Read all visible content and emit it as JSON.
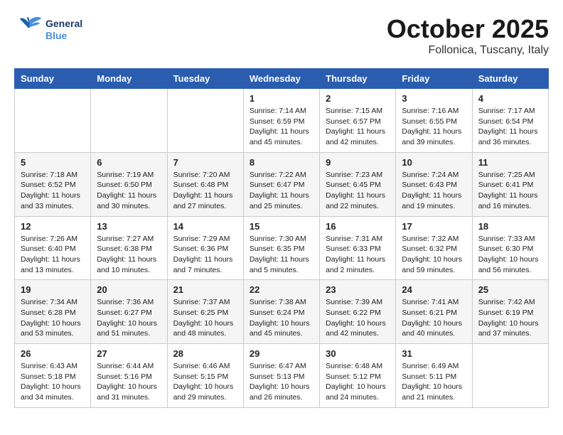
{
  "header": {
    "logo_line1": "General",
    "logo_line2": "Blue",
    "month_title": "October 2025",
    "location": "Follonica, Tuscany, Italy"
  },
  "days_of_week": [
    "Sunday",
    "Monday",
    "Tuesday",
    "Wednesday",
    "Thursday",
    "Friday",
    "Saturday"
  ],
  "weeks": [
    [
      {
        "day": "",
        "info": ""
      },
      {
        "day": "",
        "info": ""
      },
      {
        "day": "",
        "info": ""
      },
      {
        "day": "1",
        "info": "Sunrise: 7:14 AM\nSunset: 6:59 PM\nDaylight: 11 hours\nand 45 minutes."
      },
      {
        "day": "2",
        "info": "Sunrise: 7:15 AM\nSunset: 6:57 PM\nDaylight: 11 hours\nand 42 minutes."
      },
      {
        "day": "3",
        "info": "Sunrise: 7:16 AM\nSunset: 6:55 PM\nDaylight: 11 hours\nand 39 minutes."
      },
      {
        "day": "4",
        "info": "Sunrise: 7:17 AM\nSunset: 6:54 PM\nDaylight: 11 hours\nand 36 minutes."
      }
    ],
    [
      {
        "day": "5",
        "info": "Sunrise: 7:18 AM\nSunset: 6:52 PM\nDaylight: 11 hours\nand 33 minutes."
      },
      {
        "day": "6",
        "info": "Sunrise: 7:19 AM\nSunset: 6:50 PM\nDaylight: 11 hours\nand 30 minutes."
      },
      {
        "day": "7",
        "info": "Sunrise: 7:20 AM\nSunset: 6:48 PM\nDaylight: 11 hours\nand 27 minutes."
      },
      {
        "day": "8",
        "info": "Sunrise: 7:22 AM\nSunset: 6:47 PM\nDaylight: 11 hours\nand 25 minutes."
      },
      {
        "day": "9",
        "info": "Sunrise: 7:23 AM\nSunset: 6:45 PM\nDaylight: 11 hours\nand 22 minutes."
      },
      {
        "day": "10",
        "info": "Sunrise: 7:24 AM\nSunset: 6:43 PM\nDaylight: 11 hours\nand 19 minutes."
      },
      {
        "day": "11",
        "info": "Sunrise: 7:25 AM\nSunset: 6:41 PM\nDaylight: 11 hours\nand 16 minutes."
      }
    ],
    [
      {
        "day": "12",
        "info": "Sunrise: 7:26 AM\nSunset: 6:40 PM\nDaylight: 11 hours\nand 13 minutes."
      },
      {
        "day": "13",
        "info": "Sunrise: 7:27 AM\nSunset: 6:38 PM\nDaylight: 11 hours\nand 10 minutes."
      },
      {
        "day": "14",
        "info": "Sunrise: 7:29 AM\nSunset: 6:36 PM\nDaylight: 11 hours\nand 7 minutes."
      },
      {
        "day": "15",
        "info": "Sunrise: 7:30 AM\nSunset: 6:35 PM\nDaylight: 11 hours\nand 5 minutes."
      },
      {
        "day": "16",
        "info": "Sunrise: 7:31 AM\nSunset: 6:33 PM\nDaylight: 11 hours\nand 2 minutes."
      },
      {
        "day": "17",
        "info": "Sunrise: 7:32 AM\nSunset: 6:32 PM\nDaylight: 10 hours\nand 59 minutes."
      },
      {
        "day": "18",
        "info": "Sunrise: 7:33 AM\nSunset: 6:30 PM\nDaylight: 10 hours\nand 56 minutes."
      }
    ],
    [
      {
        "day": "19",
        "info": "Sunrise: 7:34 AM\nSunset: 6:28 PM\nDaylight: 10 hours\nand 53 minutes."
      },
      {
        "day": "20",
        "info": "Sunrise: 7:36 AM\nSunset: 6:27 PM\nDaylight: 10 hours\nand 51 minutes."
      },
      {
        "day": "21",
        "info": "Sunrise: 7:37 AM\nSunset: 6:25 PM\nDaylight: 10 hours\nand 48 minutes."
      },
      {
        "day": "22",
        "info": "Sunrise: 7:38 AM\nSunset: 6:24 PM\nDaylight: 10 hours\nand 45 minutes."
      },
      {
        "day": "23",
        "info": "Sunrise: 7:39 AM\nSunset: 6:22 PM\nDaylight: 10 hours\nand 42 minutes."
      },
      {
        "day": "24",
        "info": "Sunrise: 7:41 AM\nSunset: 6:21 PM\nDaylight: 10 hours\nand 40 minutes."
      },
      {
        "day": "25",
        "info": "Sunrise: 7:42 AM\nSunset: 6:19 PM\nDaylight: 10 hours\nand 37 minutes."
      }
    ],
    [
      {
        "day": "26",
        "info": "Sunrise: 6:43 AM\nSunset: 5:18 PM\nDaylight: 10 hours\nand 34 minutes."
      },
      {
        "day": "27",
        "info": "Sunrise: 6:44 AM\nSunset: 5:16 PM\nDaylight: 10 hours\nand 31 minutes."
      },
      {
        "day": "28",
        "info": "Sunrise: 6:46 AM\nSunset: 5:15 PM\nDaylight: 10 hours\nand 29 minutes."
      },
      {
        "day": "29",
        "info": "Sunrise: 6:47 AM\nSunset: 5:13 PM\nDaylight: 10 hours\nand 26 minutes."
      },
      {
        "day": "30",
        "info": "Sunrise: 6:48 AM\nSunset: 5:12 PM\nDaylight: 10 hours\nand 24 minutes."
      },
      {
        "day": "31",
        "info": "Sunrise: 6:49 AM\nSunset: 5:11 PM\nDaylight: 10 hours\nand 21 minutes."
      },
      {
        "day": "",
        "info": ""
      }
    ]
  ]
}
